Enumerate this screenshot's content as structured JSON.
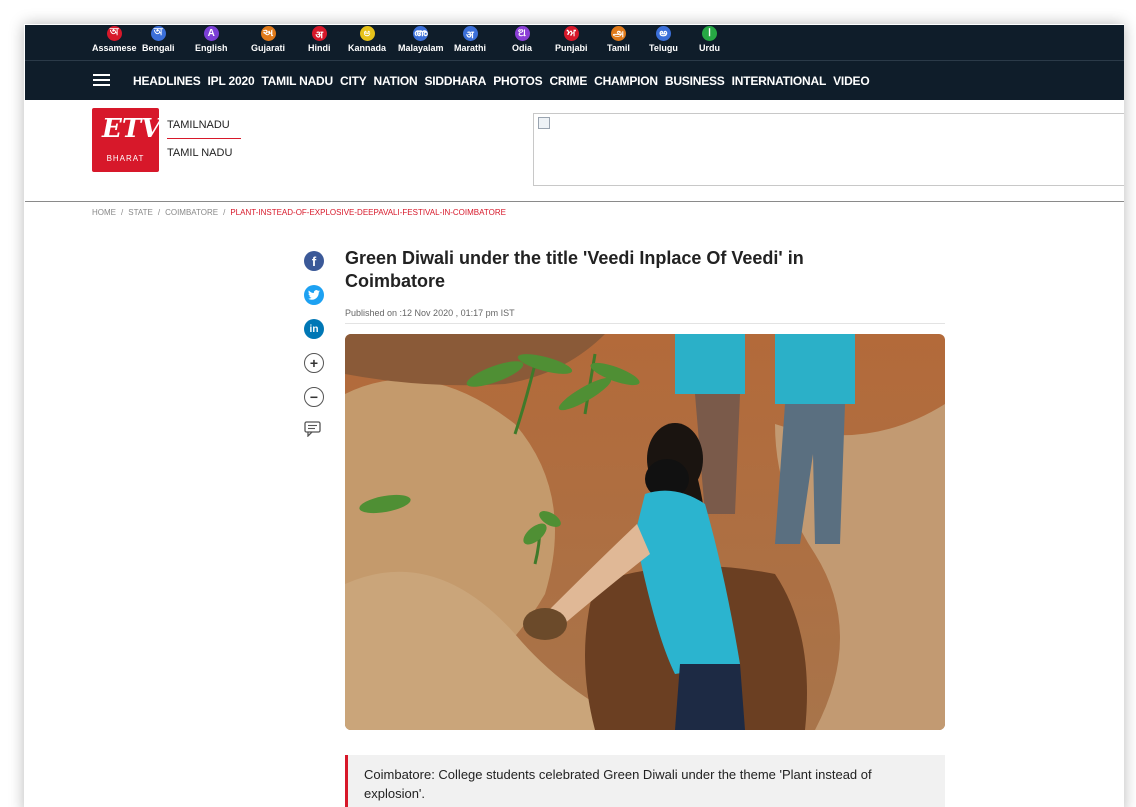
{
  "languages": [
    {
      "name": "Assamese",
      "glyph": "অ",
      "color": "#d7182a"
    },
    {
      "name": "Bengali",
      "glyph": "অ",
      "color": "#3b6fd8"
    },
    {
      "name": "English",
      "glyph": "A",
      "color": "#7b3fd6"
    },
    {
      "name": "Gujarati",
      "glyph": "અ",
      "color": "#e07a1a"
    },
    {
      "name": "Hindi",
      "glyph": "अ",
      "color": "#d7182a"
    },
    {
      "name": "Kannada",
      "glyph": "ಅ",
      "color": "#e6c21a"
    },
    {
      "name": "Malayalam",
      "glyph": "അ",
      "color": "#3b6fd8"
    },
    {
      "name": "Marathi",
      "glyph": "अ",
      "color": "#3b6fd8"
    },
    {
      "name": "Odia",
      "glyph": "ଅ",
      "color": "#8b3fd6"
    },
    {
      "name": "Punjabi",
      "glyph": "ਅ",
      "color": "#d7182a"
    },
    {
      "name": "Tamil",
      "glyph": "அ",
      "color": "#e07a1a"
    },
    {
      "name": "Telugu",
      "glyph": "అ",
      "color": "#3b6fd8"
    },
    {
      "name": "Urdu",
      "glyph": "ا",
      "color": "#27a844"
    }
  ],
  "nav": {
    "items": [
      "HEADLINES",
      "IPL 2020",
      "TAMIL NADU",
      "CITY",
      "NATION",
      "SIDDHARA",
      "PHOTOS",
      "CRIME",
      "CHAMPION",
      "BUSINESS",
      "INTERNATIONAL",
      "VIDEO"
    ]
  },
  "header": {
    "logo_text": "ETV",
    "logo_sub": "BHARAT",
    "state_label": "TAMILNADU",
    "state_name": "TAMIL NADU"
  },
  "breadcrumb": {
    "items": [
      "HOME",
      "STATE",
      "COIMBATORE"
    ],
    "current": "PLANT-INSTEAD-OF-EXPLOSIVE-DEEPAVALI-FESTIVAL-IN-COIMBATORE"
  },
  "article": {
    "title": "Green Diwali under the title 'Veedi Inplace Of Veedi' in Coimbatore",
    "published": "Published on :12 Nov 2020 , 01:17 pm IST",
    "summary": "Coimbatore: College students celebrated Green Diwali under the theme 'Plant instead of explosion'."
  },
  "share": {
    "facebook_icon": "f",
    "twitter_icon": "t",
    "linkedin_icon": "in",
    "zoom_in": "+",
    "zoom_out": "−"
  },
  "colors": {
    "topbar": "#0f1d2a",
    "brand_red": "#d7182a"
  }
}
